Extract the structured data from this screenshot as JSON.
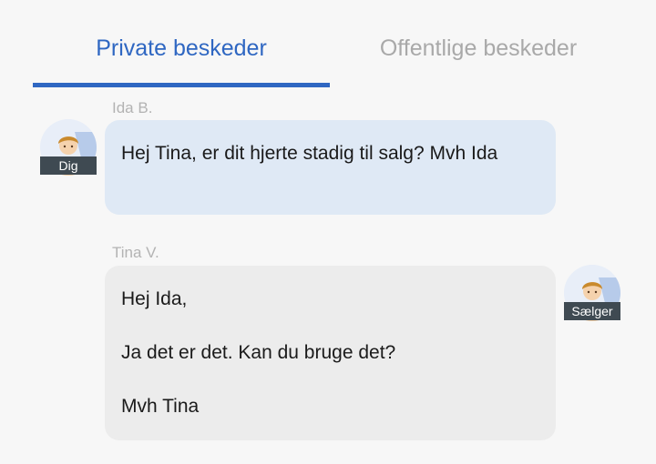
{
  "tabs": {
    "private_label": "Private beskeder",
    "public_label": "Offentlige beskeder"
  },
  "messages": [
    {
      "sender": "Ida B.",
      "avatar_tag": "Dig",
      "lines": [
        "Hej Tina, er dit hjerte stadig til salg? Mvh Ida"
      ]
    },
    {
      "sender": "Tina V.",
      "avatar_tag": "Sælger",
      "lines": [
        "Hej Ida,",
        "Ja det er det. Kan du bruge det?",
        "Mvh Tina"
      ]
    }
  ],
  "colors": {
    "accent": "#2f67c2",
    "inactive_tab": "#a9a9a9",
    "my_bubble": "#dfe9f5",
    "their_bubble": "#ececec",
    "tag_bg": "#3f4a52"
  },
  "icons": {
    "avatar": "user-avatar-icon"
  }
}
